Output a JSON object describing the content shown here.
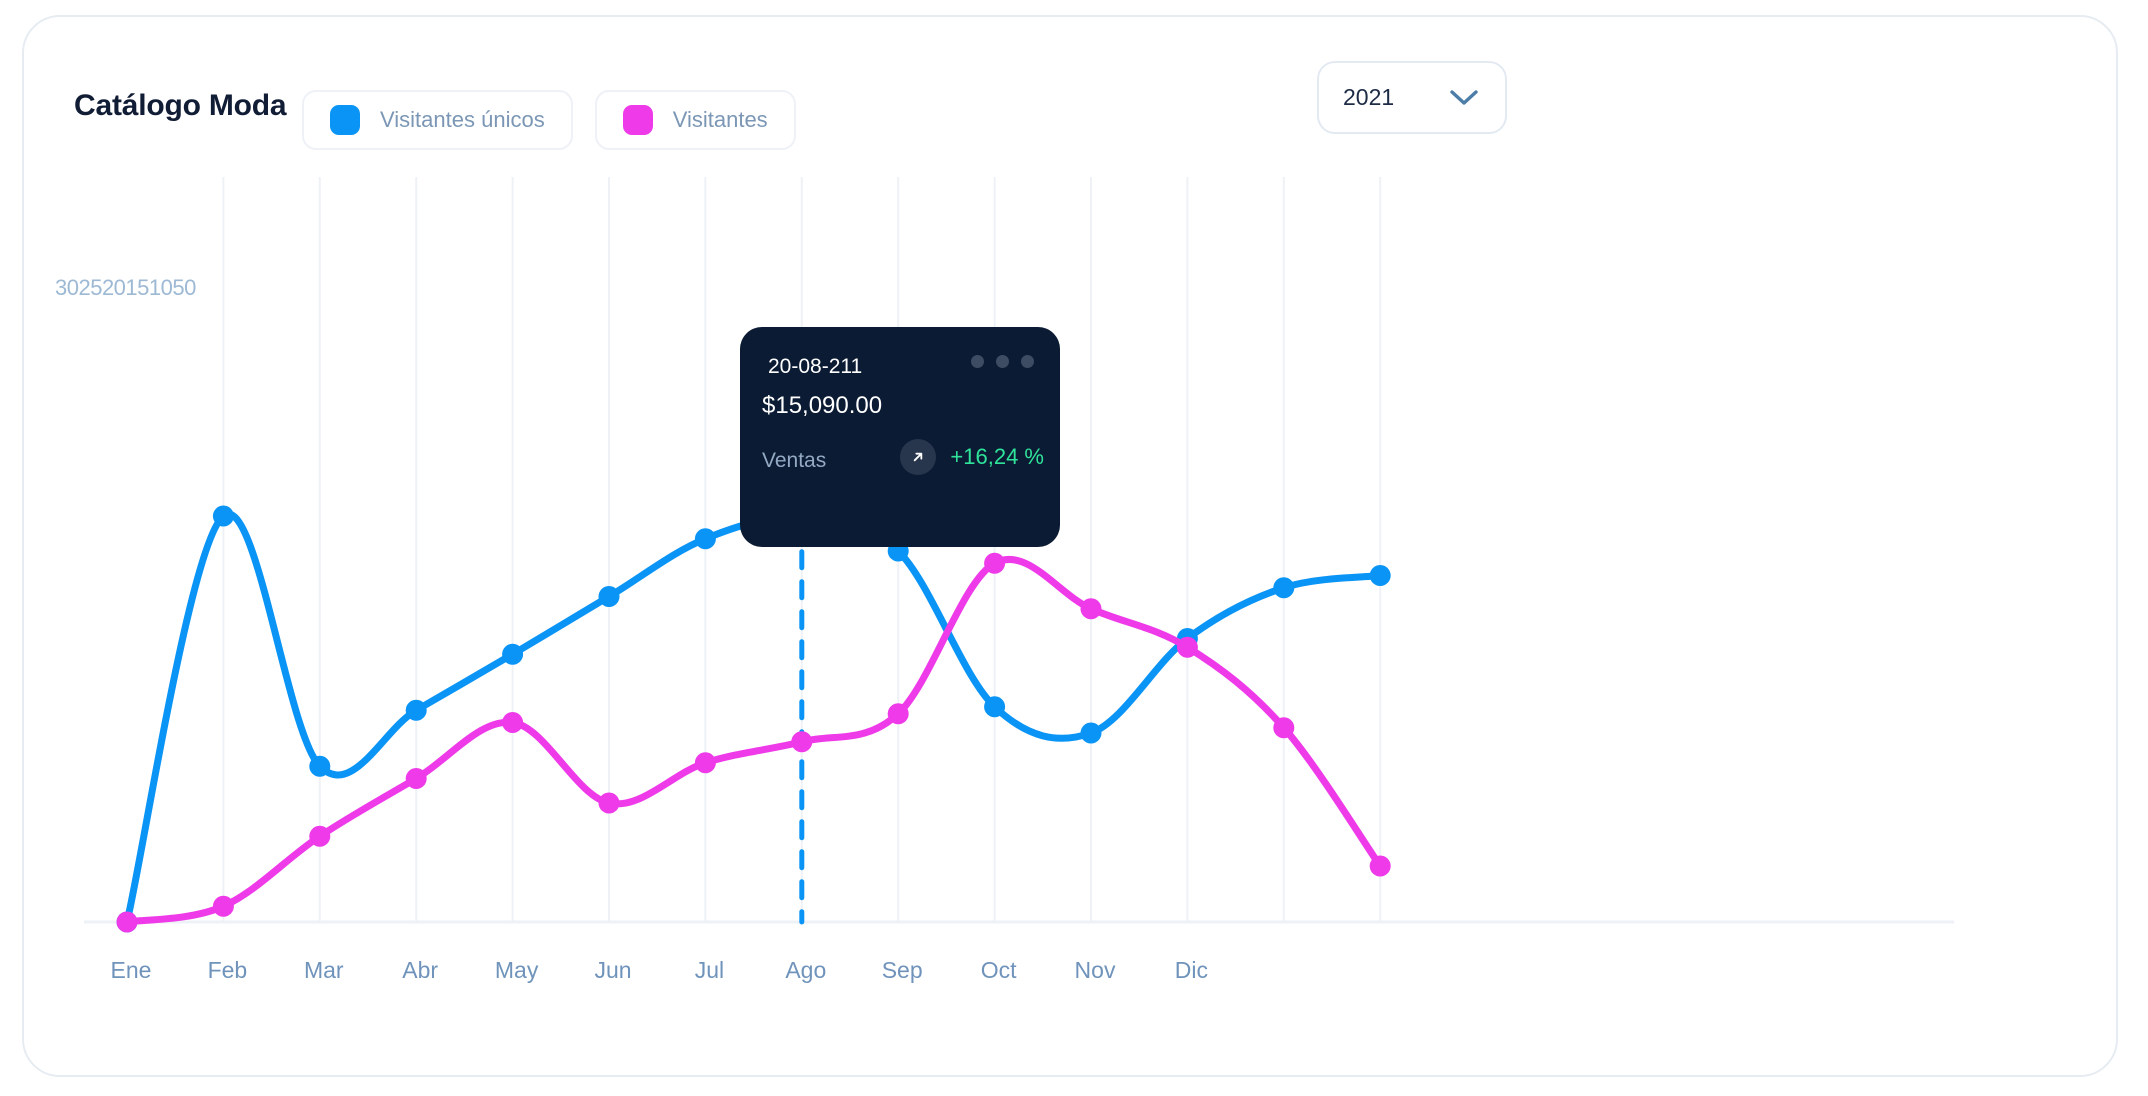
{
  "header": {
    "title": "Catálogo Moda",
    "legend": [
      {
        "label": "Visitantes únicos",
        "color": "#0a94f5",
        "swatch_icon": "square-swatch-icon"
      },
      {
        "label": "Visitantes",
        "color": "#ee3ae8",
        "swatch_icon": "square-swatch-icon"
      }
    ],
    "year_select": {
      "value": "2021",
      "icon": "chevron-down-icon"
    }
  },
  "tooltip": {
    "date": "20-08-211",
    "amount": "$15,090.00",
    "metric_label": "Ventas",
    "delta": "+16,24 %",
    "delta_color": "#2fe39b",
    "trend_icon": "arrow-up-right-icon",
    "window_dots": 3
  },
  "chart_data": {
    "type": "line",
    "title": "Catálogo Moda",
    "xlabel": "",
    "ylabel": "",
    "grid": true,
    "legend_position": "top",
    "ylim": [
      0,
      30
    ],
    "yticks": [
      30,
      25,
      20,
      15,
      10,
      5,
      0
    ],
    "ytick_text": "302520151050",
    "categories": [
      "Ene",
      "Feb",
      "Mar",
      "Abr",
      "May",
      "Jun",
      "Jul",
      "Ago",
      "Sep",
      "Oct",
      "Nov",
      "Dic"
    ],
    "x_points": 14,
    "series": [
      {
        "name": "Visitantes únicos",
        "color": "#0a94f5",
        "values": [
          0,
          23.2,
          8.9,
          12.1,
          15.3,
          18.6,
          21.9,
          23.1,
          21.2,
          12.3,
          10.8,
          16.2,
          19.1,
          19.8
        ]
      },
      {
        "name": "Visitantes",
        "color": "#ee3ae8",
        "values": [
          0,
          0.9,
          4.9,
          8.2,
          11.4,
          6.8,
          9.1,
          10.3,
          11.9,
          20.5,
          17.9,
          15.7,
          11.1,
          3.2
        ]
      }
    ],
    "highlight": {
      "index": 7,
      "label": "Ago",
      "guide": "dashed-vertical"
    }
  }
}
